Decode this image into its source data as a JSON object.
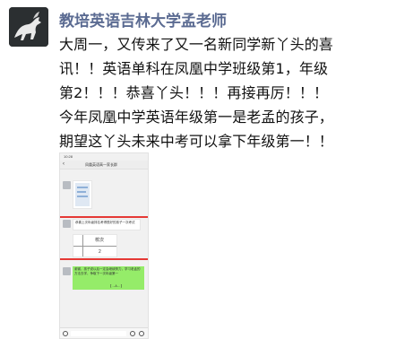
{
  "post": {
    "author": "教培英语吉林大学孟老师",
    "lines": [
      "大周一，又传来了又一名新同学新丫头的喜",
      "讯！！英语单科在凤凰中学班级第1，年级",
      "第2！！！恭喜丫头！！！再接再厉！！！",
      "今年凤凰中学英语年级第一是老孟的孩子，",
      "期望这丫头未来中考可以拿下年级第一！！"
    ]
  },
  "screenshot": {
    "status_time": "10:28",
    "nav_back": "‹",
    "chat_title": "凤凰英语高一家长群",
    "message_text": "恭喜上次年级排名考得很好的孩子一次考试",
    "rank_header": "校次",
    "rank_value": "2",
    "reply_text": "谢谢，孩子说以后一定会继续努力，学习老孟的方法去学，争取下一次年级第一",
    "reply_tail": "【 ...A... 】",
    "colors": {
      "highlight": "#e53935",
      "chat_green": "#95ec69",
      "author": "#5b6b92"
    }
  }
}
